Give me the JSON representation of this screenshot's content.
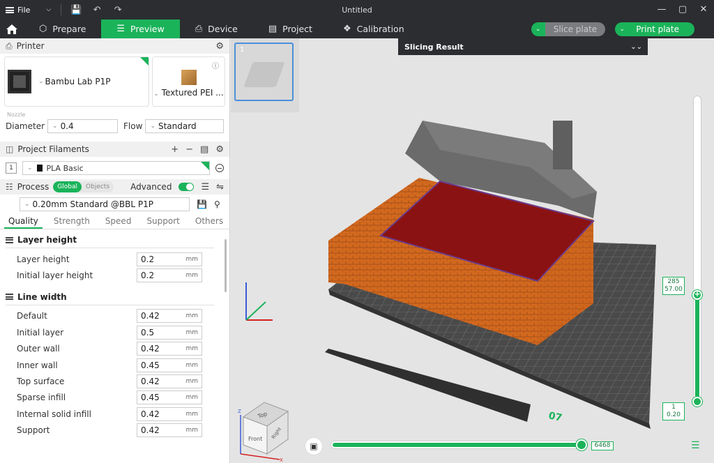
{
  "window": {
    "file_label": "File",
    "title": "Untitled"
  },
  "tabs": [
    {
      "label": "Prepare"
    },
    {
      "label": "Preview"
    },
    {
      "label": "Device"
    },
    {
      "label": "Project"
    },
    {
      "label": "Calibration"
    }
  ],
  "actions": {
    "slice_plate": "Slice plate",
    "print_plate": "Print plate"
  },
  "printer": {
    "section_title": "Printer",
    "name": "Bambu Lab P1P",
    "plate_type": "Textured PEI ...",
    "nozzle_label": "Nozzle",
    "diameter_label": "Diameter",
    "diameter_value": "0.4",
    "flow_label": "Flow",
    "flow_value": "Standard"
  },
  "filaments": {
    "section_title": "Project Filaments",
    "items": [
      {
        "index": "1",
        "name": "PLA Basic",
        "color": "#111111"
      }
    ]
  },
  "process": {
    "section_title": "Process",
    "toggle_global": "Global",
    "toggle_objects": "Objects",
    "advanced_label": "Advanced",
    "preset": "0.20mm Standard @BBL P1P",
    "subtabs": [
      "Quality",
      "Strength",
      "Speed",
      "Support",
      "Others"
    ],
    "groups": [
      {
        "title": "Layer height",
        "params": [
          {
            "label": "Layer height",
            "value": "0.2",
            "unit": "mm"
          },
          {
            "label": "Initial layer height",
            "value": "0.2",
            "unit": "mm"
          }
        ]
      },
      {
        "title": "Line width",
        "params": [
          {
            "label": "Default",
            "value": "0.42",
            "unit": "mm"
          },
          {
            "label": "Initial layer",
            "value": "0.5",
            "unit": "mm"
          },
          {
            "label": "Outer wall",
            "value": "0.42",
            "unit": "mm"
          },
          {
            "label": "Inner wall",
            "value": "0.45",
            "unit": "mm"
          },
          {
            "label": "Top surface",
            "value": "0.42",
            "unit": "mm"
          },
          {
            "label": "Sparse infill",
            "value": "0.45",
            "unit": "mm"
          },
          {
            "label": "Internal solid infill",
            "value": "0.42",
            "unit": "mm"
          },
          {
            "label": "Support",
            "value": "0.42",
            "unit": "mm"
          }
        ]
      }
    ]
  },
  "viewport": {
    "plate_number": "1",
    "slicing_result_title": "Slicing Result",
    "plate_label": "07",
    "cube_top": "Top",
    "cube_front": "Front",
    "cube_side": "Right",
    "axis_z": "Z",
    "axis_x": "X",
    "layer_top": "285",
    "height_top": "57.00",
    "layer_bottom": "1",
    "height_bottom": "0.20",
    "move_count": "6468",
    "layer_fraction": 1.0,
    "move_fraction": 1.0
  },
  "colors": {
    "accent": "#1bb35a",
    "dark_bar": "#2b2d30"
  }
}
